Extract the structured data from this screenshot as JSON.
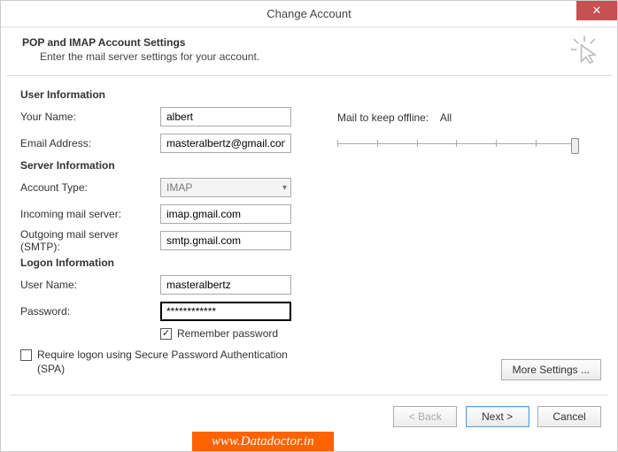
{
  "window": {
    "title": "Change Account",
    "close": "✕"
  },
  "header": {
    "title": "POP and IMAP Account Settings",
    "subtitle": "Enter the mail server settings for your account."
  },
  "sections": {
    "user": "User Information",
    "server": "Server Information",
    "logon": "Logon Information"
  },
  "labels": {
    "yourName": "Your Name:",
    "email": "Email Address:",
    "accountType": "Account Type:",
    "incoming": "Incoming mail server:",
    "outgoing": "Outgoing mail server (SMTP):",
    "userName": "User Name:",
    "password": "Password:",
    "remember": "Remember password",
    "spa": "Require logon using Secure Password Authentication (SPA)",
    "mailOffline": "Mail to keep offline:",
    "all": "All"
  },
  "values": {
    "yourName": "albert",
    "email": "masteralbertz@gmail.com",
    "accountType": "IMAP",
    "incoming": "imap.gmail.com",
    "outgoing": "smtp.gmail.com",
    "userName": "masteralbertz",
    "password": "************",
    "rememberChecked": "✓",
    "spaChecked": ""
  },
  "buttons": {
    "moreSettings": "More Settings ...",
    "back": "< Back",
    "next": "Next >",
    "cancel": "Cancel"
  },
  "brand": "www.Datadoctor.in"
}
